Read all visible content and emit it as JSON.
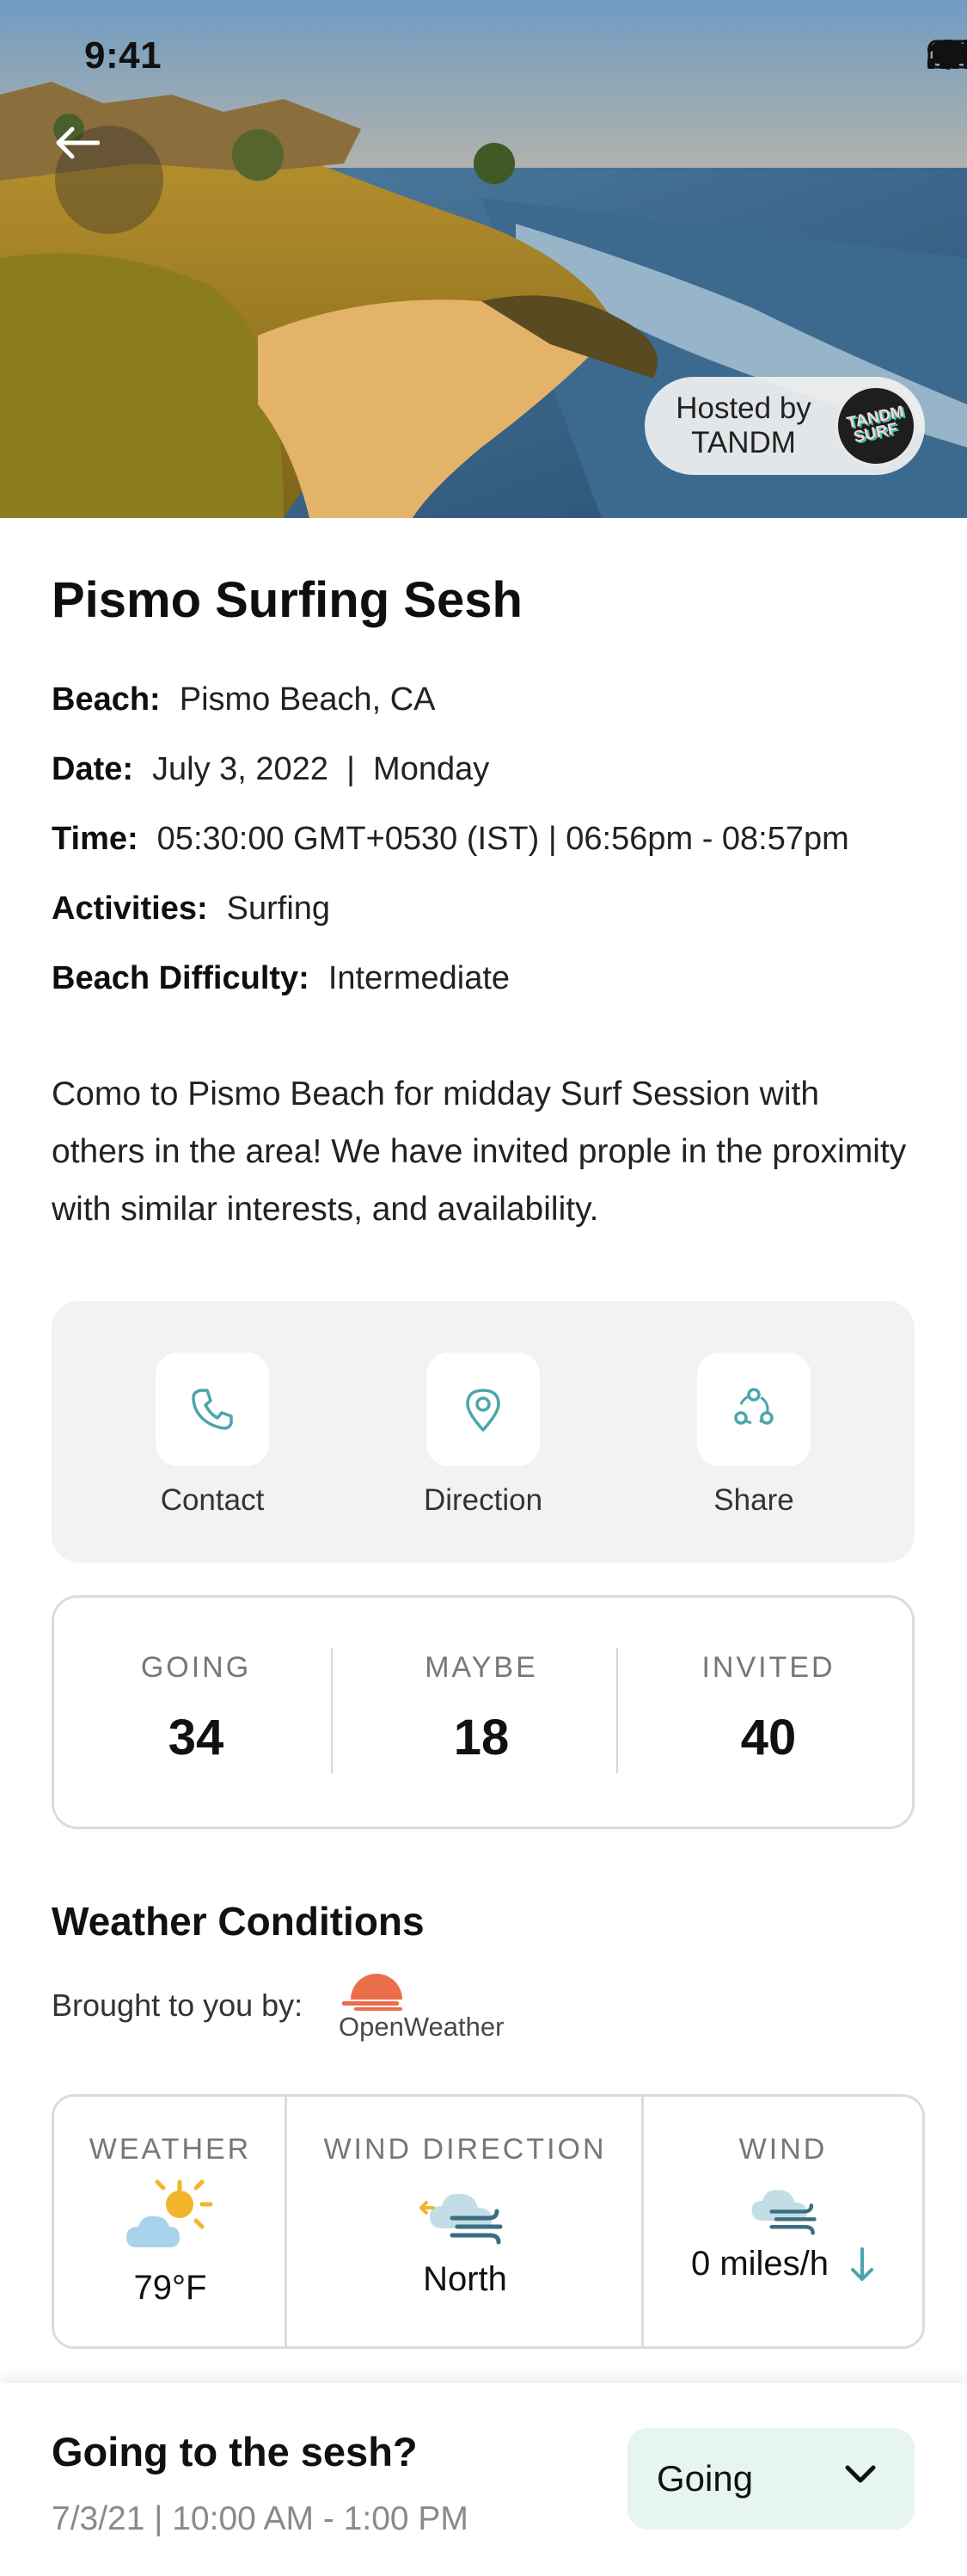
{
  "status_bar": {
    "time": "9:41"
  },
  "hero": {
    "host_line1": "Hosted by",
    "host_line2": "TANDM",
    "host_logo_text": [
      "TANDM",
      "SURF"
    ]
  },
  "event": {
    "title": "Pismo Surfing Sesh",
    "details": [
      {
        "label": "Beach:",
        "value": "Pismo Beach, CA"
      },
      {
        "label": "Date:",
        "value": "July 3, 2022  |  Monday"
      },
      {
        "label": "Time:",
        "value": "05:30:00 GMT+0530 (IST) | 06:56pm - 08:57pm"
      },
      {
        "label": "Activities:",
        "value": "Surfing"
      },
      {
        "label": "Beach Difficulty:",
        "value": "Intermediate"
      }
    ],
    "description": "Como to Pismo Beach for midday Surf Session with others in the area! We have invited prople in the proximity with similar interests, and availability."
  },
  "actions": [
    {
      "label": "Contact",
      "icon": "phone-icon"
    },
    {
      "label": "Direction",
      "icon": "map-pin-icon"
    },
    {
      "label": "Share",
      "icon": "share-icon"
    }
  ],
  "stats": [
    {
      "label": "GOING",
      "value": "34"
    },
    {
      "label": "MAYBE",
      "value": "18"
    },
    {
      "label": "INVITED",
      "value": "40"
    }
  ],
  "weather": {
    "title": "Weather Conditions",
    "brought_by": "Brought to you by:",
    "provider": "OpenWeather",
    "columns": [
      {
        "label": "WEATHER",
        "value": "79°F",
        "icon": "sun-cloud-icon"
      },
      {
        "label": "WIND DIRECTION",
        "value": "North",
        "icon": "wind-cloud-icon"
      },
      {
        "label": "WIND",
        "value": "0 miles/h",
        "icon": "wind-cloud-icon"
      }
    ]
  },
  "bottom_bar": {
    "question": "Going to the sesh?",
    "datetime": "7/3/21 | 10:00 AM - 1:00 PM",
    "rsvp_value": "Going"
  },
  "colors": {
    "accent_teal": "#4aa6ab",
    "rsvp_bg": "#e6f4f2",
    "panel_bg": "#f2f2f2",
    "openweather_orange": "#eb6e4b"
  }
}
